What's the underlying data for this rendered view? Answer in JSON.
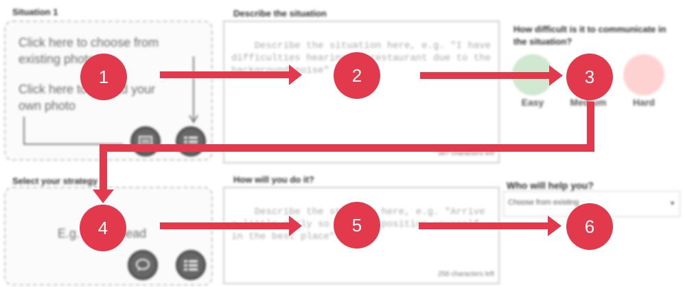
{
  "situation": {
    "title": "Situation 1",
    "choose_text": "Click here to choose from existing photos",
    "upload_text": "Click here to upload your own photo"
  },
  "describe": {
    "title": "Describe the situation",
    "placeholder": "Describe the situation here, e.g. \"I have difficulties hearing in restaurant due to the background noise\"",
    "chars_left": "387 characters left"
  },
  "difficulty": {
    "title": "How difficult is it to communicate in the situation?",
    "options": [
      {
        "label": "Easy",
        "color": "#cfe8cf"
      },
      {
        "label": "Medium",
        "color": "#f2e6b3"
      },
      {
        "label": "Hard",
        "color": "#ffd2d2"
      }
    ]
  },
  "strategy": {
    "title": "Select your strategy",
    "example": "E.g. Plan Ahead"
  },
  "how": {
    "title": "How will you do it?",
    "placeholder": "Describe the strategy here, e.g. \"Arrive a little early so you can position yourself in the best place\"",
    "chars_left": "258 characters left"
  },
  "helper": {
    "title": "Who will help you?",
    "select_value": "Choose from existing"
  },
  "steps": [
    "1",
    "2",
    "3",
    "4",
    "5",
    "6"
  ],
  "colors": {
    "accent": "#e23a4c"
  }
}
